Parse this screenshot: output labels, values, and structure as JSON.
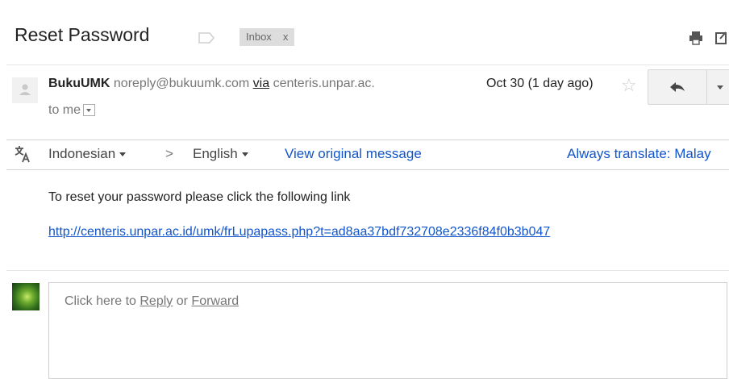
{
  "thread": {
    "subject": "Reset Password",
    "label": "Inbox",
    "label_remove": "x"
  },
  "message": {
    "sender_name": "BukuUMK",
    "sender_email": "noreply@bukuumk.com",
    "via_word": "via",
    "via_domain": "centeris.unpar.ac.",
    "recipient": "to me",
    "date": "Oct 30 (1 day ago)",
    "body_text": "To reset your password please click the following link",
    "body_link": "http://centeris.unpar.ac.id/umk/frLupapass.php?t=ad8aa37bdf732708e2336f84f0b3b047"
  },
  "translate": {
    "from_lang": "Indonesian",
    "arrow": ">",
    "to_lang": "English",
    "view_original": "View original message",
    "always_translate": "Always translate: Malay"
  },
  "reply": {
    "prefix": "Click here to",
    "reply_link": "Reply",
    "or_word": "or",
    "forward_link": "Forward"
  },
  "colors": {
    "link": "#1155cc",
    "label_bg": "#dddddd"
  }
}
